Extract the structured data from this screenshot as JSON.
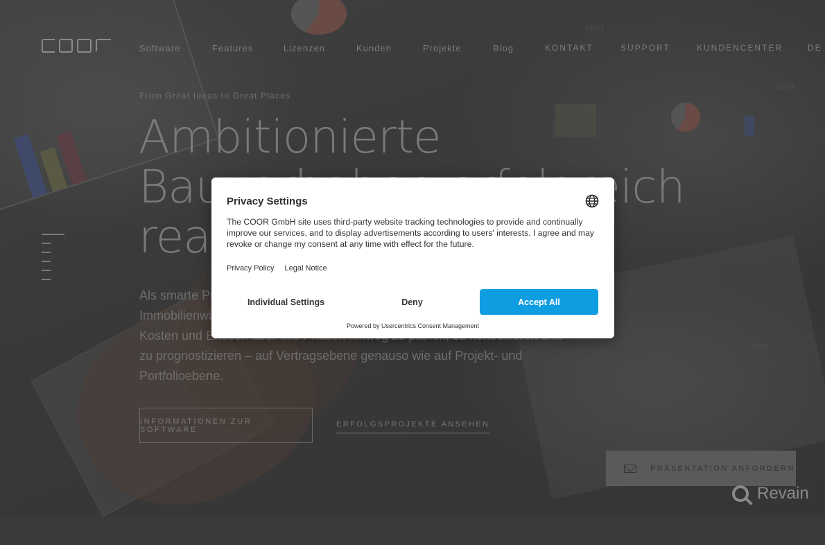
{
  "nav": {
    "logo": "coor",
    "items": [
      {
        "label": "Software"
      },
      {
        "label": "Features"
      },
      {
        "label": "Lizenzen"
      },
      {
        "label": "Kunden"
      },
      {
        "label": "Projekte"
      },
      {
        "label": "Blog"
      },
      {
        "label": "KONTAKT"
      },
      {
        "label": "SUPPORT"
      },
      {
        "label": "KUNDENCENTER"
      },
      {
        "label": "DE"
      }
    ]
  },
  "hero": {
    "subtitle": "From Great Ideas to Great Places",
    "title_lines": [
      "Ambitionierte",
      "Bauvorhaben erfolgreich",
      "realisieren"
    ],
    "body": "Als smarte Projektmanagement-Software für die Bau- und Immobilienwirtschaft ermöglicht COOR es Ihnen, Kosten und Erlösen über alle Phasen hinweg zu planen, zu kontrollieren und zu prognostizieren – auf Vertragsebene genauso wie auf Projekt- und Portfolioebene.",
    "body_lines": [
      "Als smarte Projektmanagement-Software für die Bau- und",
      "Immobilienwirtschaft ermöglicht COOR es Ihnen,",
      "Kosten und Erlösen über alle Phasen hinweg zu planen, zu kontrollieren und",
      "zu prognostizieren – auf Vertragsebene genauso wie auf Projekt- und",
      "Portfolioebene."
    ],
    "cta_primary": "INFORMATIONEN ZUR SOFTWARE",
    "cta_secondary": "ERFOLGSPROJEKTE ANSEHEN"
  },
  "present_button": "PRÄSENTATION ANFORDERN",
  "watermark": "Revain",
  "consent": {
    "title": "Privacy Settings",
    "text": "The COOR GmbH site uses third-party website tracking technologies to provide and continually improve our services, and to display advertisements according to users' interests. I agree and may revoke or change my consent at any time with effect for the future.",
    "links": [
      "Privacy Policy",
      "Legal Notice"
    ],
    "buttons": {
      "individual": "Individual Settings",
      "deny": "Deny",
      "accept": "Accept All"
    },
    "powered_by": "Powered by Usercentrics Consent Management",
    "accent_color": "#0f9de2"
  }
}
